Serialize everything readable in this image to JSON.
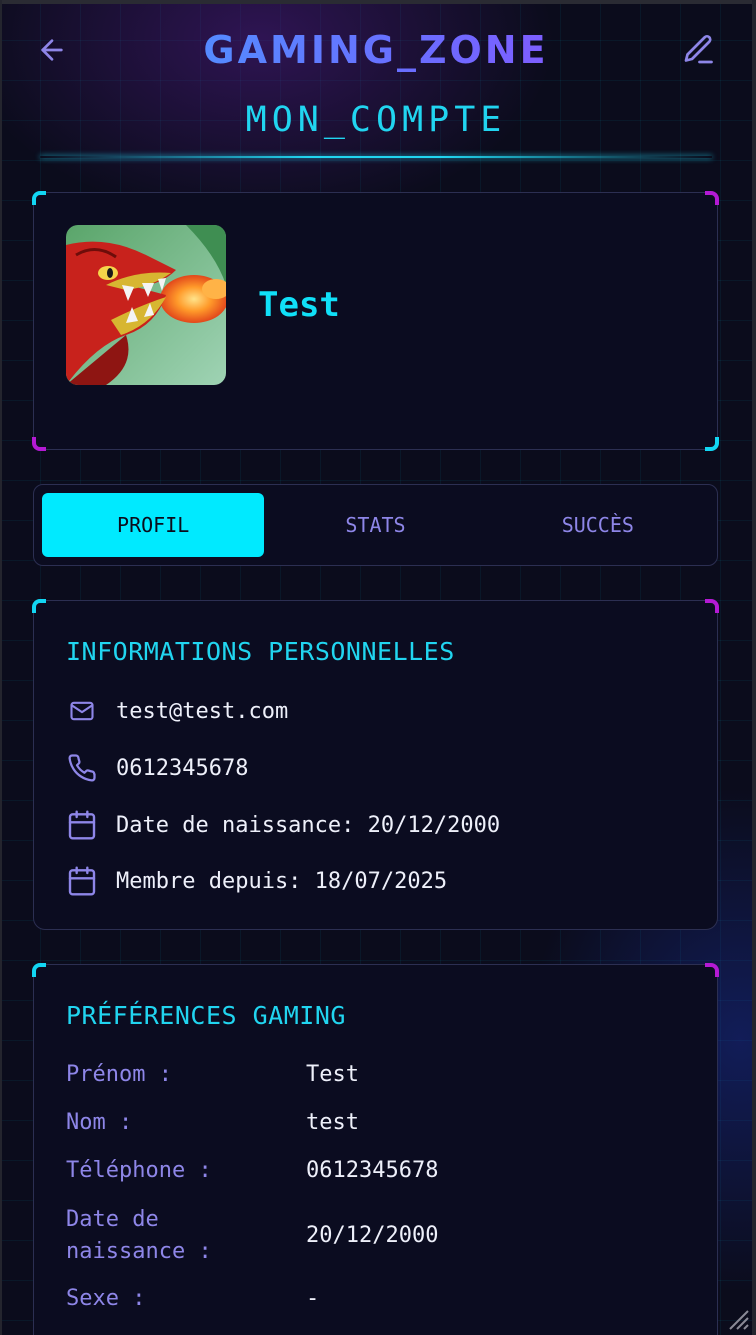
{
  "header": {
    "app_title": "GAMING_ZONE",
    "page_subtitle": "MON_COMPTE",
    "back_icon": "arrow-left-icon",
    "edit_icon": "pencil-icon"
  },
  "profile": {
    "username": "Test",
    "avatar_icon": "dragon-avatar-image"
  },
  "tabs": [
    {
      "label": "PROFIL",
      "active": true
    },
    {
      "label": "STATS",
      "active": false
    },
    {
      "label": "SUCCÈS",
      "active": false
    }
  ],
  "personal_info": {
    "title": "INFORMATIONS PERSONNELLES",
    "email": "test@test.com",
    "phone": "0612345678",
    "birth_date": "Date de naissance: 20/12/2000",
    "member_since": "Membre depuis: 18/07/2025"
  },
  "gaming_prefs": {
    "title": "PRÉFÉRENCES GAMING",
    "rows": [
      {
        "label": "Prénom :",
        "value": "Test"
      },
      {
        "label": "Nom :",
        "value": "test"
      },
      {
        "label": "Téléphone :",
        "value": "0612345678"
      },
      {
        "label": "Date de naissance :",
        "value": "20/12/2000"
      },
      {
        "label": "Sexe :",
        "value": "-"
      }
    ]
  },
  "colors": {
    "accent_cyan": "#00eaff",
    "accent_purple": "#b41ad4",
    "label_purple": "#8e86e8",
    "background": "#0b0c1c"
  }
}
